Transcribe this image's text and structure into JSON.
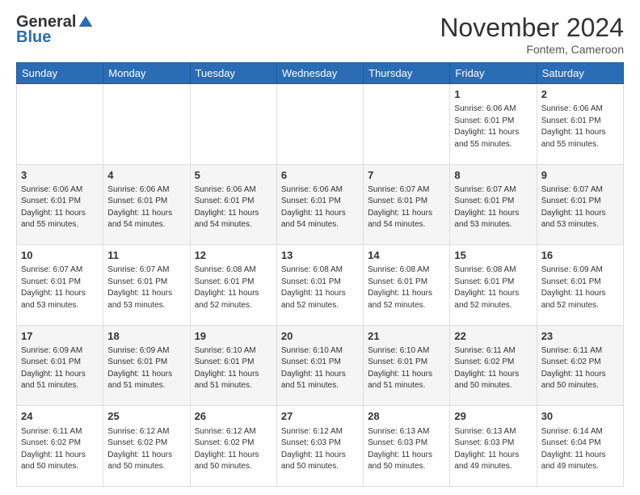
{
  "header": {
    "logo_general": "General",
    "logo_blue": "Blue",
    "month_title": "November 2024",
    "location": "Fontem, Cameroon"
  },
  "weekdays": [
    "Sunday",
    "Monday",
    "Tuesday",
    "Wednesday",
    "Thursday",
    "Friday",
    "Saturday"
  ],
  "weeks": [
    [
      {
        "day": "",
        "sunrise": "",
        "sunset": "",
        "daylight": ""
      },
      {
        "day": "",
        "sunrise": "",
        "sunset": "",
        "daylight": ""
      },
      {
        "day": "",
        "sunrise": "",
        "sunset": "",
        "daylight": ""
      },
      {
        "day": "",
        "sunrise": "",
        "sunset": "",
        "daylight": ""
      },
      {
        "day": "",
        "sunrise": "",
        "sunset": "",
        "daylight": ""
      },
      {
        "day": "1",
        "sunrise": "Sunrise: 6:06 AM",
        "sunset": "Sunset: 6:01 PM",
        "daylight": "Daylight: 11 hours and 55 minutes."
      },
      {
        "day": "2",
        "sunrise": "Sunrise: 6:06 AM",
        "sunset": "Sunset: 6:01 PM",
        "daylight": "Daylight: 11 hours and 55 minutes."
      }
    ],
    [
      {
        "day": "3",
        "sunrise": "Sunrise: 6:06 AM",
        "sunset": "Sunset: 6:01 PM",
        "daylight": "Daylight: 11 hours and 55 minutes."
      },
      {
        "day": "4",
        "sunrise": "Sunrise: 6:06 AM",
        "sunset": "Sunset: 6:01 PM",
        "daylight": "Daylight: 11 hours and 54 minutes."
      },
      {
        "day": "5",
        "sunrise": "Sunrise: 6:06 AM",
        "sunset": "Sunset: 6:01 PM",
        "daylight": "Daylight: 11 hours and 54 minutes."
      },
      {
        "day": "6",
        "sunrise": "Sunrise: 6:06 AM",
        "sunset": "Sunset: 6:01 PM",
        "daylight": "Daylight: 11 hours and 54 minutes."
      },
      {
        "day": "7",
        "sunrise": "Sunrise: 6:07 AM",
        "sunset": "Sunset: 6:01 PM",
        "daylight": "Daylight: 11 hours and 54 minutes."
      },
      {
        "day": "8",
        "sunrise": "Sunrise: 6:07 AM",
        "sunset": "Sunset: 6:01 PM",
        "daylight": "Daylight: 11 hours and 53 minutes."
      },
      {
        "day": "9",
        "sunrise": "Sunrise: 6:07 AM",
        "sunset": "Sunset: 6:01 PM",
        "daylight": "Daylight: 11 hours and 53 minutes."
      }
    ],
    [
      {
        "day": "10",
        "sunrise": "Sunrise: 6:07 AM",
        "sunset": "Sunset: 6:01 PM",
        "daylight": "Daylight: 11 hours and 53 minutes."
      },
      {
        "day": "11",
        "sunrise": "Sunrise: 6:07 AM",
        "sunset": "Sunset: 6:01 PM",
        "daylight": "Daylight: 11 hours and 53 minutes."
      },
      {
        "day": "12",
        "sunrise": "Sunrise: 6:08 AM",
        "sunset": "Sunset: 6:01 PM",
        "daylight": "Daylight: 11 hours and 52 minutes."
      },
      {
        "day": "13",
        "sunrise": "Sunrise: 6:08 AM",
        "sunset": "Sunset: 6:01 PM",
        "daylight": "Daylight: 11 hours and 52 minutes."
      },
      {
        "day": "14",
        "sunrise": "Sunrise: 6:08 AM",
        "sunset": "Sunset: 6:01 PM",
        "daylight": "Daylight: 11 hours and 52 minutes."
      },
      {
        "day": "15",
        "sunrise": "Sunrise: 6:08 AM",
        "sunset": "Sunset: 6:01 PM",
        "daylight": "Daylight: 11 hours and 52 minutes."
      },
      {
        "day": "16",
        "sunrise": "Sunrise: 6:09 AM",
        "sunset": "Sunset: 6:01 PM",
        "daylight": "Daylight: 11 hours and 52 minutes."
      }
    ],
    [
      {
        "day": "17",
        "sunrise": "Sunrise: 6:09 AM",
        "sunset": "Sunset: 6:01 PM",
        "daylight": "Daylight: 11 hours and 51 minutes."
      },
      {
        "day": "18",
        "sunrise": "Sunrise: 6:09 AM",
        "sunset": "Sunset: 6:01 PM",
        "daylight": "Daylight: 11 hours and 51 minutes."
      },
      {
        "day": "19",
        "sunrise": "Sunrise: 6:10 AM",
        "sunset": "Sunset: 6:01 PM",
        "daylight": "Daylight: 11 hours and 51 minutes."
      },
      {
        "day": "20",
        "sunrise": "Sunrise: 6:10 AM",
        "sunset": "Sunset: 6:01 PM",
        "daylight": "Daylight: 11 hours and 51 minutes."
      },
      {
        "day": "21",
        "sunrise": "Sunrise: 6:10 AM",
        "sunset": "Sunset: 6:01 PM",
        "daylight": "Daylight: 11 hours and 51 minutes."
      },
      {
        "day": "22",
        "sunrise": "Sunrise: 6:11 AM",
        "sunset": "Sunset: 6:02 PM",
        "daylight": "Daylight: 11 hours and 50 minutes."
      },
      {
        "day": "23",
        "sunrise": "Sunrise: 6:11 AM",
        "sunset": "Sunset: 6:02 PM",
        "daylight": "Daylight: 11 hours and 50 minutes."
      }
    ],
    [
      {
        "day": "24",
        "sunrise": "Sunrise: 6:11 AM",
        "sunset": "Sunset: 6:02 PM",
        "daylight": "Daylight: 11 hours and 50 minutes."
      },
      {
        "day": "25",
        "sunrise": "Sunrise: 6:12 AM",
        "sunset": "Sunset: 6:02 PM",
        "daylight": "Daylight: 11 hours and 50 minutes."
      },
      {
        "day": "26",
        "sunrise": "Sunrise: 6:12 AM",
        "sunset": "Sunset: 6:02 PM",
        "daylight": "Daylight: 11 hours and 50 minutes."
      },
      {
        "day": "27",
        "sunrise": "Sunrise: 6:12 AM",
        "sunset": "Sunset: 6:03 PM",
        "daylight": "Daylight: 11 hours and 50 minutes."
      },
      {
        "day": "28",
        "sunrise": "Sunrise: 6:13 AM",
        "sunset": "Sunset: 6:03 PM",
        "daylight": "Daylight: 11 hours and 50 minutes."
      },
      {
        "day": "29",
        "sunrise": "Sunrise: 6:13 AM",
        "sunset": "Sunset: 6:03 PM",
        "daylight": "Daylight: 11 hours and 49 minutes."
      },
      {
        "day": "30",
        "sunrise": "Sunrise: 6:14 AM",
        "sunset": "Sunset: 6:04 PM",
        "daylight": "Daylight: 11 hours and 49 minutes."
      }
    ]
  ]
}
